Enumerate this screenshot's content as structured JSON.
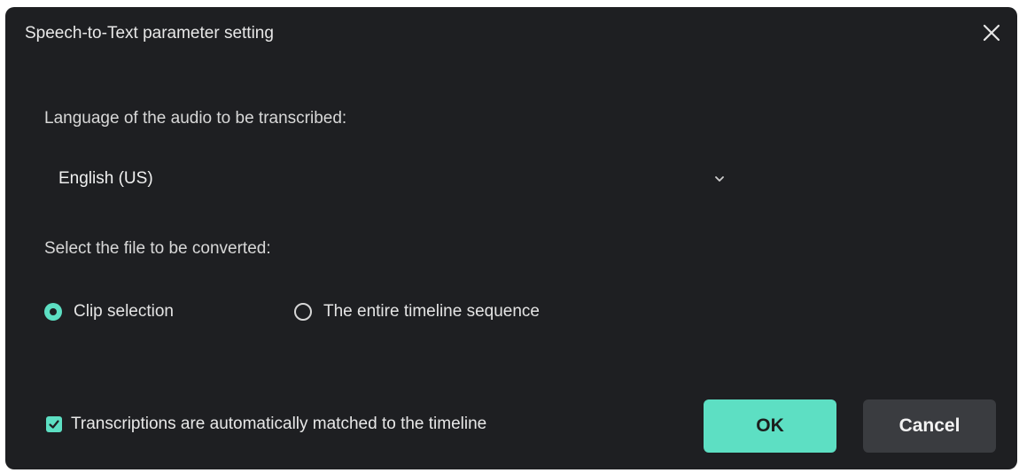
{
  "dialog": {
    "title": "Speech-to-Text parameter setting"
  },
  "language": {
    "label": "Language of the audio to be transcribed:",
    "selected": "English (US)"
  },
  "file": {
    "label": "Select the file to be converted:",
    "options": [
      {
        "label": "Clip selection",
        "checked": true
      },
      {
        "label": "The entire timeline sequence",
        "checked": false
      }
    ]
  },
  "auto_match": {
    "label": "Transcriptions are automatically matched to the timeline",
    "checked": true
  },
  "buttons": {
    "ok": "OK",
    "cancel": "Cancel"
  },
  "colors": {
    "accent": "#5ddfc3",
    "background": "#1e1f22",
    "secondary_button": "#3a3c40"
  },
  "icons": {
    "close": "close-icon",
    "dropdown": "chevron-down-icon",
    "check": "checkmark-icon"
  }
}
